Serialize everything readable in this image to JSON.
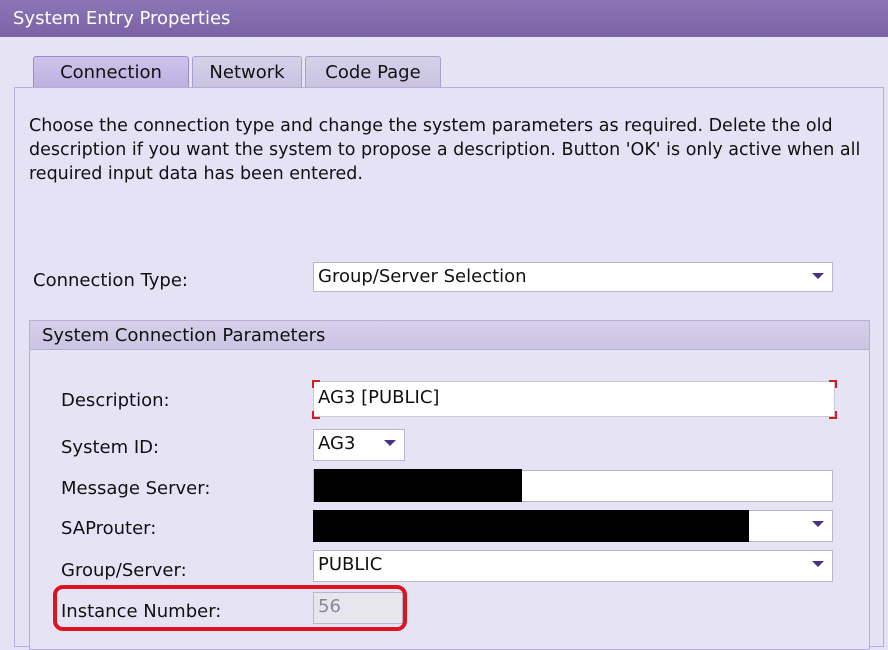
{
  "window": {
    "title": "System Entry Properties"
  },
  "tabs": [
    {
      "label": "Connection",
      "active": true
    },
    {
      "label": "Network",
      "active": false
    },
    {
      "label": "Code Page",
      "active": false
    }
  ],
  "instruction": "Choose the connection type and change the system parameters as required. Delete the old description if you want the system to propose a description. Button 'OK' is only active when all required input data has been entered.",
  "connection_type": {
    "label": "Connection Type:",
    "value": "Group/Server Selection"
  },
  "params": {
    "header": "System Connection Parameters",
    "description": {
      "label": "Description:",
      "value": "AG3 [PUBLIC]"
    },
    "system_id": {
      "label": "System ID:",
      "value": "AG3"
    },
    "message_server": {
      "label": "Message Server:",
      "value": ""
    },
    "saprouter": {
      "label": "SAProuter:",
      "value": ""
    },
    "group_server": {
      "label": "Group/Server:",
      "value": "PUBLIC"
    },
    "instance_number": {
      "label": "Instance Number:",
      "value": "56"
    }
  },
  "colors": {
    "accent": "#4b2f8a",
    "highlight": "#d9161e",
    "titlebar": "#7f68ad"
  },
  "icons": {
    "dropdown": "chevron-down-icon"
  }
}
